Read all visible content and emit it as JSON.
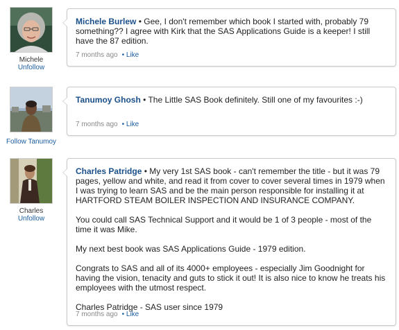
{
  "comments": [
    {
      "author_name": "Michele",
      "author_action": "Unfollow",
      "poster": "Michele Burlew",
      "separator": " • ",
      "paragraphs": [
        "Gee, I don't remember which book I started with, probably 79 something?? I agree with Kirk that the SAS Applications Guide is a keeper! I still have the 87 edition."
      ],
      "time": "7 months ago",
      "like": "• Like"
    },
    {
      "author_name": "",
      "author_action": "Follow Tanumoy",
      "poster": "Tanumoy Ghosh",
      "separator": " • ",
      "paragraphs": [
        "The Little SAS Book definitely. Still one of my favourites :-)"
      ],
      "time": "7 months ago",
      "like": "• Like"
    },
    {
      "author_name": "Charles",
      "author_action": "Unfollow",
      "poster": "Charles Patridge",
      "separator": " • ",
      "paragraphs": [
        "My very 1st SAS book - can't remember the title - but it was 79 pages, yellow and white, and read it from cover to cover several times in 1979 when I was trying to learn SAS and be the main person responsible for installing it at HARTFORD STEAM BOILER INSPECTION AND INSURANCE COMPANY.",
        "You could call SAS Technical Support and it would be 1 of 3 people - most of the time it was Mike.",
        "My next best book was SAS Applications Guide - 1979 edition.",
        "Congrats to SAS and all of its 4000+ employees - especially Jim Goodnight for having the vision, tenacity and guts to stick it out! It is also nice to know he treats his employees with the utmost respect.",
        "Charles Patridge - SAS user since 1979"
      ],
      "time": "7 months ago",
      "like": "• Like"
    }
  ]
}
